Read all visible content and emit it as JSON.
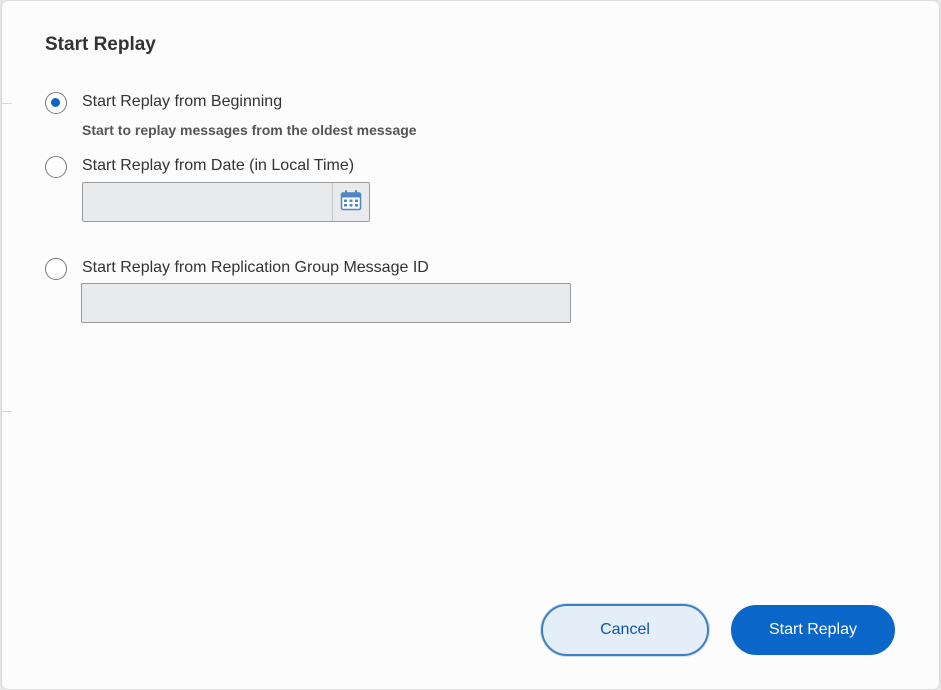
{
  "dialog": {
    "title": "Start Replay"
  },
  "options": [
    {
      "label": "Start Replay from Beginning",
      "description": "Start to replay messages from the oldest message",
      "checked": true
    },
    {
      "label": "Start Replay from Date (in Local Time)",
      "checked": false,
      "input_value": "",
      "icon": "calendar-icon"
    },
    {
      "label": "Start Replay from Replication Group Message ID",
      "checked": false,
      "input_value": ""
    }
  ],
  "buttons": {
    "cancel_label": "Cancel",
    "confirm_label": "Start Replay"
  },
  "colors": {
    "accent": "#0a66c9",
    "dialog_bg": "#fcfcfc",
    "input_bg": "#e9eaeb",
    "cancel_bg": "#e4eef8"
  }
}
